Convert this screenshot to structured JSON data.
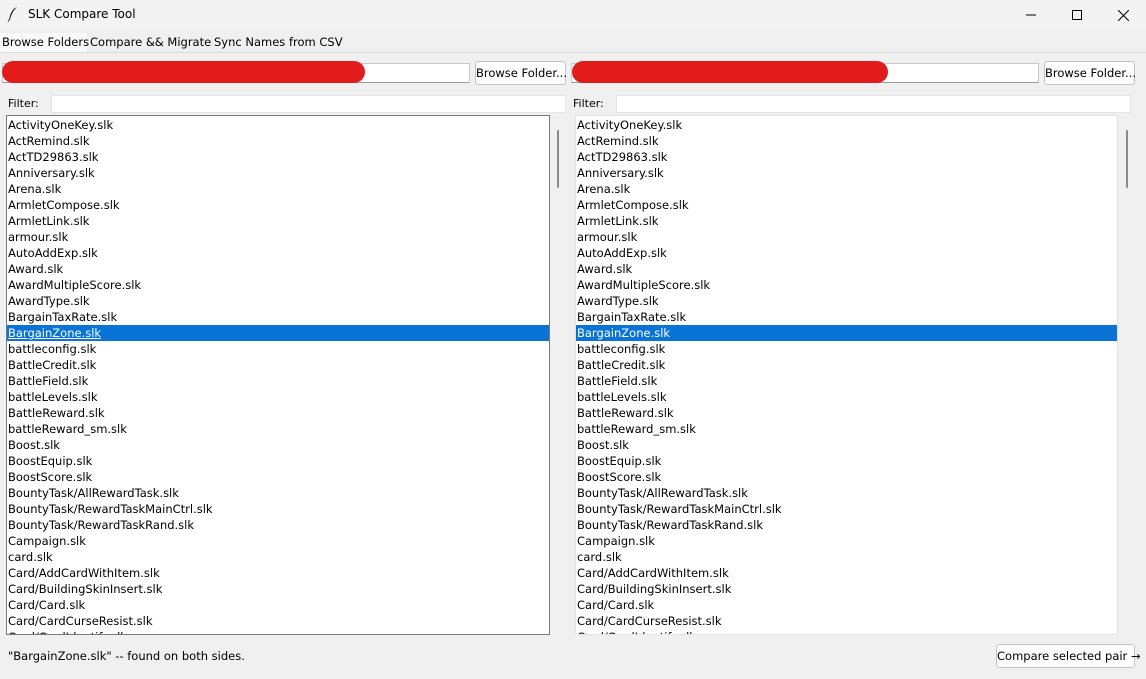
{
  "window": {
    "title": "SLK Compare Tool",
    "icon": "feather-icon",
    "controls": [
      "minimize-icon",
      "maximize-icon",
      "close-icon"
    ]
  },
  "tabs": [
    {
      "label": "Browse Folders",
      "active": true
    },
    {
      "label": "Compare && Migrate",
      "active": false
    },
    {
      "label": "Sync Names from CSV",
      "active": false
    }
  ],
  "left_panel": {
    "path_value": "",
    "browse_label": "Browse Folder...",
    "filter_label": "Filter:",
    "filter_value": "",
    "selected_index": 13
  },
  "right_panel": {
    "path_value": "",
    "browse_label": "Browse Folder...",
    "filter_label": "Filter:",
    "filter_value": "",
    "selected_index": 13
  },
  "files": [
    "ActivityOneKey.slk",
    "ActRemind.slk",
    "ActTD29863.slk",
    "Anniversary.slk",
    "Arena.slk",
    "ArmletCompose.slk",
    "ArmletLink.slk",
    "armour.slk",
    "AutoAddExp.slk",
    "Award.slk",
    "AwardMultipleScore.slk",
    "AwardType.slk",
    "BargainTaxRate.slk",
    "BargainZone.slk",
    "battleconfig.slk",
    "BattleCredit.slk",
    "BattleField.slk",
    "battleLevels.slk",
    "BattleReward.slk",
    "battleReward_sm.slk",
    "Boost.slk",
    "BoostEquip.slk",
    "BoostScore.slk",
    "BountyTask/AllRewardTask.slk",
    "BountyTask/RewardTaskMainCtrl.slk",
    "BountyTask/RewardTaskRand.slk",
    "Campaign.slk",
    "card.slk",
    "Card/AddCardWithItem.slk",
    "Card/BuildingSkinInsert.slk",
    "Card/Card.slk",
    "Card/CardCurseResist.slk",
    "Card/CardIdentify.slk"
  ],
  "status_text": "\"BargainZone.slk\" -- found on both sides.",
  "compare_button_label": "Compare selected pair →",
  "colors": {
    "selection": "#0a74d6",
    "redaction": "#e21b1b"
  }
}
